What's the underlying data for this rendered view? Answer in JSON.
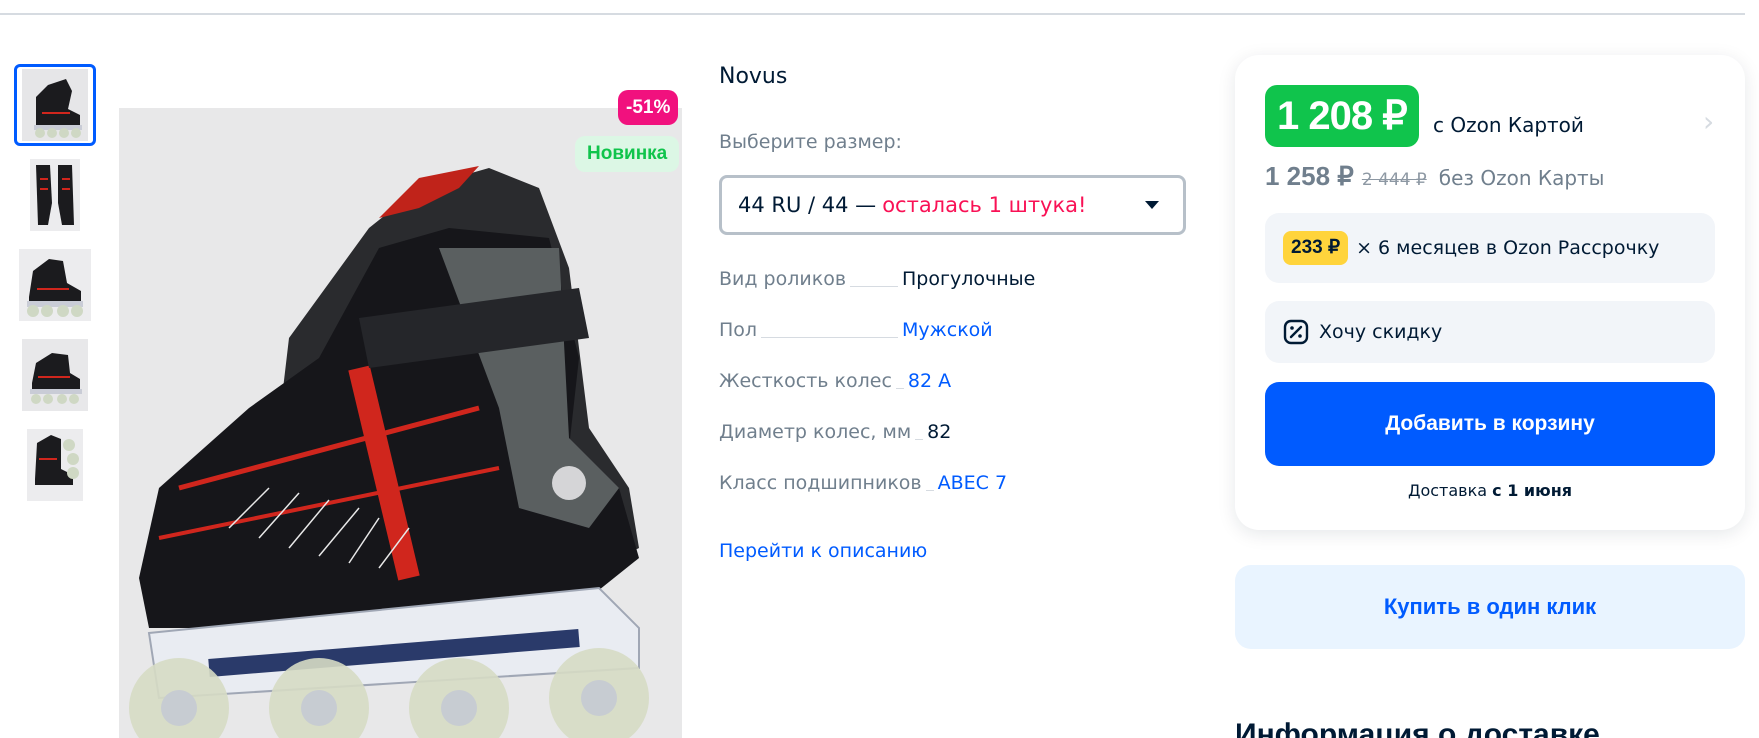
{
  "gallery": {
    "thumbnails": [
      {
        "alt": "skates-side",
        "active": true
      },
      {
        "alt": "skates-top",
        "active": false
      },
      {
        "alt": "skate-single",
        "active": false
      },
      {
        "alt": "skate-side-2",
        "active": false
      },
      {
        "alt": "skates-pair",
        "active": false
      }
    ],
    "badges": {
      "discount": "-51%",
      "new": "Новинка"
    }
  },
  "product": {
    "brand": "Novus",
    "size_label": "Выберите размер:",
    "size_selected": "44 RU / 44 —",
    "size_warning": "осталась 1 штука!",
    "specs": [
      {
        "name": "Вид роликов",
        "value": "Прогулочные",
        "link": false
      },
      {
        "name": "Пол",
        "value": "Мужской",
        "link": true
      },
      {
        "name": "Жесткость колес",
        "value": "82 A",
        "link": true
      },
      {
        "name": "Диаметр колес, мм",
        "value": "82",
        "link": false
      },
      {
        "name": "Класс подшипников",
        "value": "ABEC 7",
        "link": true
      }
    ],
    "goto_description": "Перейти к описанию"
  },
  "buy": {
    "price_card": "1 208 ₽",
    "price_card_note": "с Ozon Картой",
    "price_regular": "1 258 ₽",
    "price_old": "2 444 ₽",
    "price_regular_note": "без Ozon Карты",
    "installment_price": "233 ₽",
    "installment_text": "× 6 месяцев в Ozon Рассрочку",
    "want_discount": "Хочу скидку",
    "add_to_cart": "Добавить в корзину",
    "delivery_prefix": "Доставка",
    "delivery_date": "с 1 июня",
    "one_click": "Купить в один клик"
  },
  "delivery_info_heading": "Информация о доставке",
  "colors": {
    "accent": "#005bff",
    "green": "#10c44c",
    "pink": "#f1117e",
    "warning": "#f91155",
    "yellow": "#ffd43c"
  },
  "icons": {
    "chevron": "chevron-right-icon",
    "discount": "discount-tag-icon",
    "select": "chevron-down-icon"
  }
}
